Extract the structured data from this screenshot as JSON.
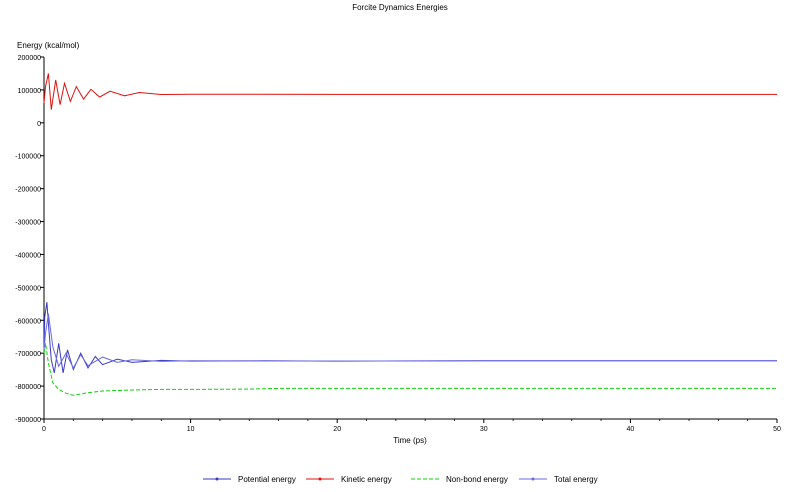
{
  "chart_data": {
    "type": "line",
    "title": "Forcite Dynamics Energies",
    "xlabel": "Time (ps)",
    "ylabel": "Energy (kcal/mol)",
    "xlim": [
      0,
      50
    ],
    "ylim": [
      -900000,
      200000
    ],
    "x_ticks": [
      0,
      10,
      20,
      30,
      40,
      50
    ],
    "y_ticks": [
      200000,
      100000,
      0,
      -100000,
      -200000,
      -300000,
      -400000,
      -500000,
      -600000,
      -700000,
      -800000,
      -900000
    ],
    "grid": false,
    "legend_position": "bottom",
    "series": [
      {
        "name": "Potential energy",
        "color": "#3a3ac8",
        "style": "solid-marker",
        "x": [
          0,
          0.05,
          0.2,
          0.3,
          0.5,
          0.7,
          1.0,
          1.3,
          1.6,
          2.0,
          2.5,
          3.0,
          3.5,
          4.0,
          5.0,
          6.0,
          8.0,
          10,
          15,
          20,
          30,
          40,
          50
        ],
        "values": [
          -700000,
          -590000,
          -545000,
          -610000,
          -720000,
          -760000,
          -670000,
          -760000,
          -690000,
          -750000,
          -700000,
          -745000,
          -710000,
          -735000,
          -718000,
          -728000,
          -722000,
          -724000,
          -723000,
          -724000,
          -723000,
          -723000,
          -723000
        ]
      },
      {
        "name": "Kinetic energy",
        "color": "#e01010",
        "style": "solid-marker",
        "x": [
          0,
          0.1,
          0.3,
          0.5,
          0.8,
          1.1,
          1.4,
          1.8,
          2.2,
          2.7,
          3.2,
          3.8,
          4.5,
          5.5,
          6.5,
          8.0,
          10,
          20,
          30,
          40,
          50
        ],
        "values": [
          60000,
          110000,
          150000,
          40000,
          130000,
          55000,
          120000,
          65000,
          110000,
          72000,
          102000,
          78000,
          96000,
          82000,
          92000,
          86000,
          87000,
          86500,
          86500,
          86500,
          86500
        ]
      },
      {
        "name": "Non-bond energy",
        "color": "#10d010",
        "style": "dashed",
        "x": [
          0,
          0.1,
          0.3,
          0.6,
          1.0,
          1.5,
          2.0,
          3.0,
          4.0,
          6.0,
          8.0,
          10,
          14,
          16,
          20,
          30,
          40,
          50
        ],
        "values": [
          -700000,
          -670000,
          -730000,
          -790000,
          -810000,
          -822000,
          -828000,
          -820000,
          -815000,
          -812000,
          -810000,
          -810000,
          -809000,
          -807000,
          -807000,
          -807000,
          -807000,
          -807000
        ]
      },
      {
        "name": "Total energy",
        "color": "#6a6ae0",
        "style": "solid-marker",
        "x": [
          0,
          0.1,
          0.3,
          0.6,
          1.0,
          1.5,
          2.0,
          2.5,
          3.0,
          4.0,
          5.0,
          6.0,
          8.0,
          10,
          20,
          30,
          40,
          50
        ],
        "values": [
          -690000,
          -640000,
          -580000,
          -680000,
          -740000,
          -700000,
          -745000,
          -705000,
          -738000,
          -712000,
          -728000,
          -720000,
          -725000,
          -723000,
          -724000,
          -723000,
          -723000,
          -723000
        ]
      }
    ]
  }
}
